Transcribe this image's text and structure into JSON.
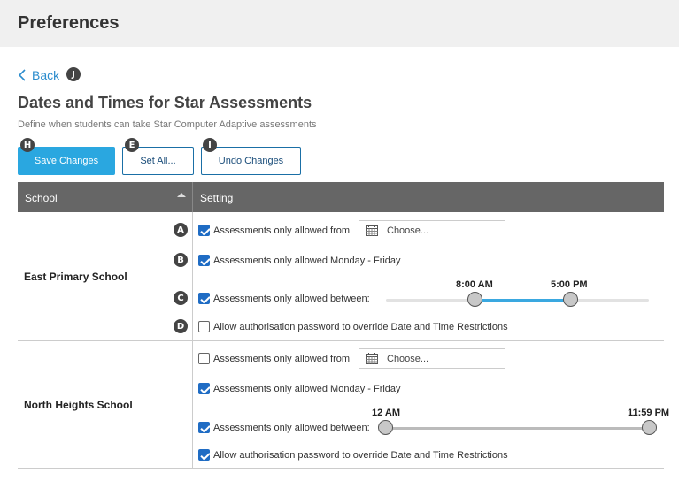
{
  "header": {
    "title": "Preferences"
  },
  "nav": {
    "back_label": "Back",
    "back_badge": "J"
  },
  "page": {
    "title": "Dates and Times for Star Assessments",
    "subtitle": "Define when students can take Star Computer Adaptive assessments"
  },
  "toolbar": {
    "save_label": "Save Changes",
    "save_badge": "H",
    "set_all_label": "Set All...",
    "set_all_badge": "E",
    "undo_label": "Undo Changes",
    "undo_badge": "I"
  },
  "table": {
    "col_school": "School",
    "col_setting": "Setting"
  },
  "rows": [
    {
      "school": "East Primary School",
      "settings": [
        {
          "badge": "A",
          "checked": true,
          "label": "Assessments only allowed from",
          "placeholder": "Choose..."
        },
        {
          "badge": "B",
          "checked": true,
          "label": "Assessments only allowed Monday - Friday"
        },
        {
          "badge": "C",
          "checked": true,
          "label": "Assessments only allowed between:",
          "start": "8:00 AM",
          "end": "5:00 PM"
        },
        {
          "badge": "D",
          "checked": false,
          "label": "Allow authorisation password to override Date and Time Restrictions"
        }
      ]
    },
    {
      "school": "North Heights School",
      "settings": [
        {
          "checked": false,
          "label": "Assessments only allowed from",
          "placeholder": "Choose..."
        },
        {
          "checked": true,
          "label": "Assessments only allowed Monday - Friday"
        },
        {
          "checked": true,
          "label": "Assessments only allowed between:",
          "start": "12 AM",
          "end": "11:59 PM"
        },
        {
          "checked": true,
          "label": "Allow authorisation password to override Date and Time Restrictions"
        }
      ]
    }
  ],
  "colors": {
    "accent": "#2aa7e0",
    "link": "#2b8ccd",
    "checkbox": "#1f6cc4",
    "range_active": "#3aa8e0",
    "range_inactive": "#bbbbbb"
  }
}
